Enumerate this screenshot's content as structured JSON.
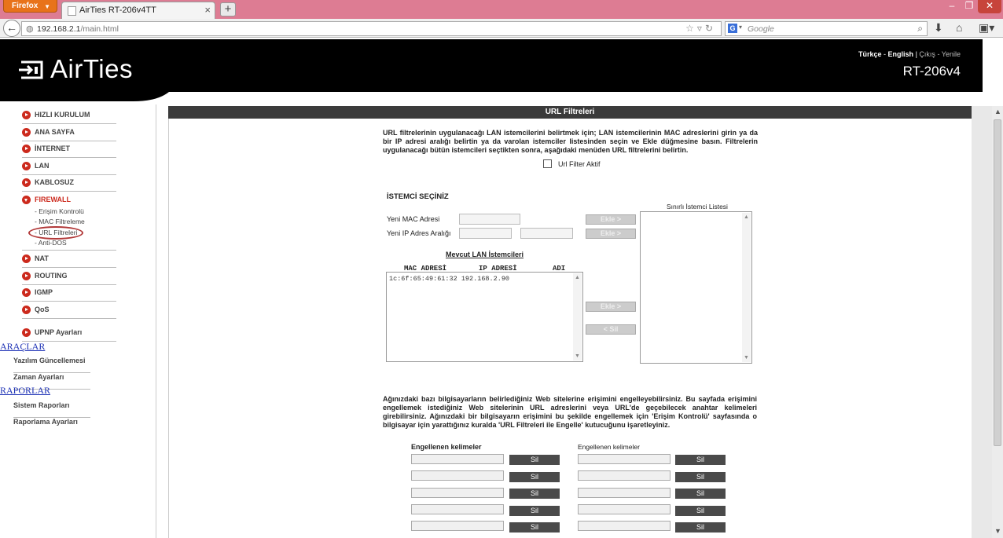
{
  "browser": {
    "app_button": "Firefox",
    "tab_title": "AirTies RT-206v4TT",
    "url_host": "192.168.2.1",
    "url_path": "/main.html",
    "search_placeholder": "Google",
    "search_engine_letter": "G"
  },
  "header": {
    "brand": "AirTies",
    "lang_tr": "Türkçe",
    "lang_sep": "-",
    "lang_en": "English",
    "links_sep": "|",
    "logout": "Çıkış",
    "links_dash": "-",
    "refresh": "Yenile",
    "model": "RT-206v4"
  },
  "menu": {
    "items": [
      {
        "label": "HIZLI KURULUM"
      },
      {
        "label": "ANA SAYFA"
      },
      {
        "label": "İNTERNET"
      },
      {
        "label": "LAN"
      },
      {
        "label": "KABLOSUZ"
      },
      {
        "label": "FIREWALL"
      },
      {
        "label": "NAT"
      },
      {
        "label": "ROUTING"
      },
      {
        "label": "IGMP"
      },
      {
        "label": "QoS"
      },
      {
        "label": "UPNP Ayarları"
      }
    ],
    "firewall_sub": [
      "- Erişim Kontrolü",
      "- MAC Filtreleme",
      "- URL Filtreleri",
      "- Anti-DOS"
    ],
    "tools_title": "ARAÇLAR",
    "tools": [
      "Yazılım Güncellemesi",
      "Zaman Ayarları"
    ],
    "reports_title": "RAPORLAR",
    "reports": [
      "Sistem Raporları",
      "Raporlama Ayarları"
    ]
  },
  "main": {
    "title": "URL Filtreleri",
    "intro": "URL filtrelerinin uygulanacağı LAN istemcilerini belirtmek için; LAN istemcilerinin MAC adreslerini girin ya da bir IP adresi aralığı belirtin ya da varolan istemciler listesinden seçin ve Ekle düğmesine basın. Filtrelerin uygulanacağı bütün istemcileri seçtikten sonra, aşağıdaki menüden URL filtrelerini belirtin.",
    "filter_active_label": "Url Filter Aktif",
    "filter_active_checked": false,
    "client_section_title": "İSTEMCİ SEÇİNİZ",
    "new_mac_label": "Yeni MAC Adresi",
    "new_ip_label": "Yeni IP Adres Aralığı",
    "add_btn": "Ekle >",
    "remove_btn": "< Sil",
    "restricted_list_label": "Sınırlı İstemci Listesi",
    "current_lan_title": "Mevcut LAN İstemcileri",
    "lan_columns": [
      "MAC ADRESİ",
      "IP ADRESİ",
      "ADI"
    ],
    "lan_clients": [
      {
        "mac": "1c:6f:65:49:61:32",
        "ip": "192.168.2.90",
        "name": ""
      }
    ],
    "block_text": "Ağınızdaki bazı bilgisayarların belirlediğiniz Web sitelerine erişimini engelleyebilirsiniz. Bu sayfada erişimini engellemek istediğiniz Web sitelerinin URL adreslerini veya URL'de geçebilecek anahtar kelimeleri girebilirsiniz. Ağınızdaki bir bilgisayarın erişimini bu şekilde engellemek için 'Erişim Kontrolü' sayfasında o bilgisayar için yarattığınız kuralda 'URL Filtreleri ile Engelle' kutucuğunu işaretleyiniz.",
    "blocked_words_header_left": "Engellenen kelimeler",
    "blocked_words_header_right": "Engellenen kelimeler",
    "delete_btn": "Sil"
  }
}
